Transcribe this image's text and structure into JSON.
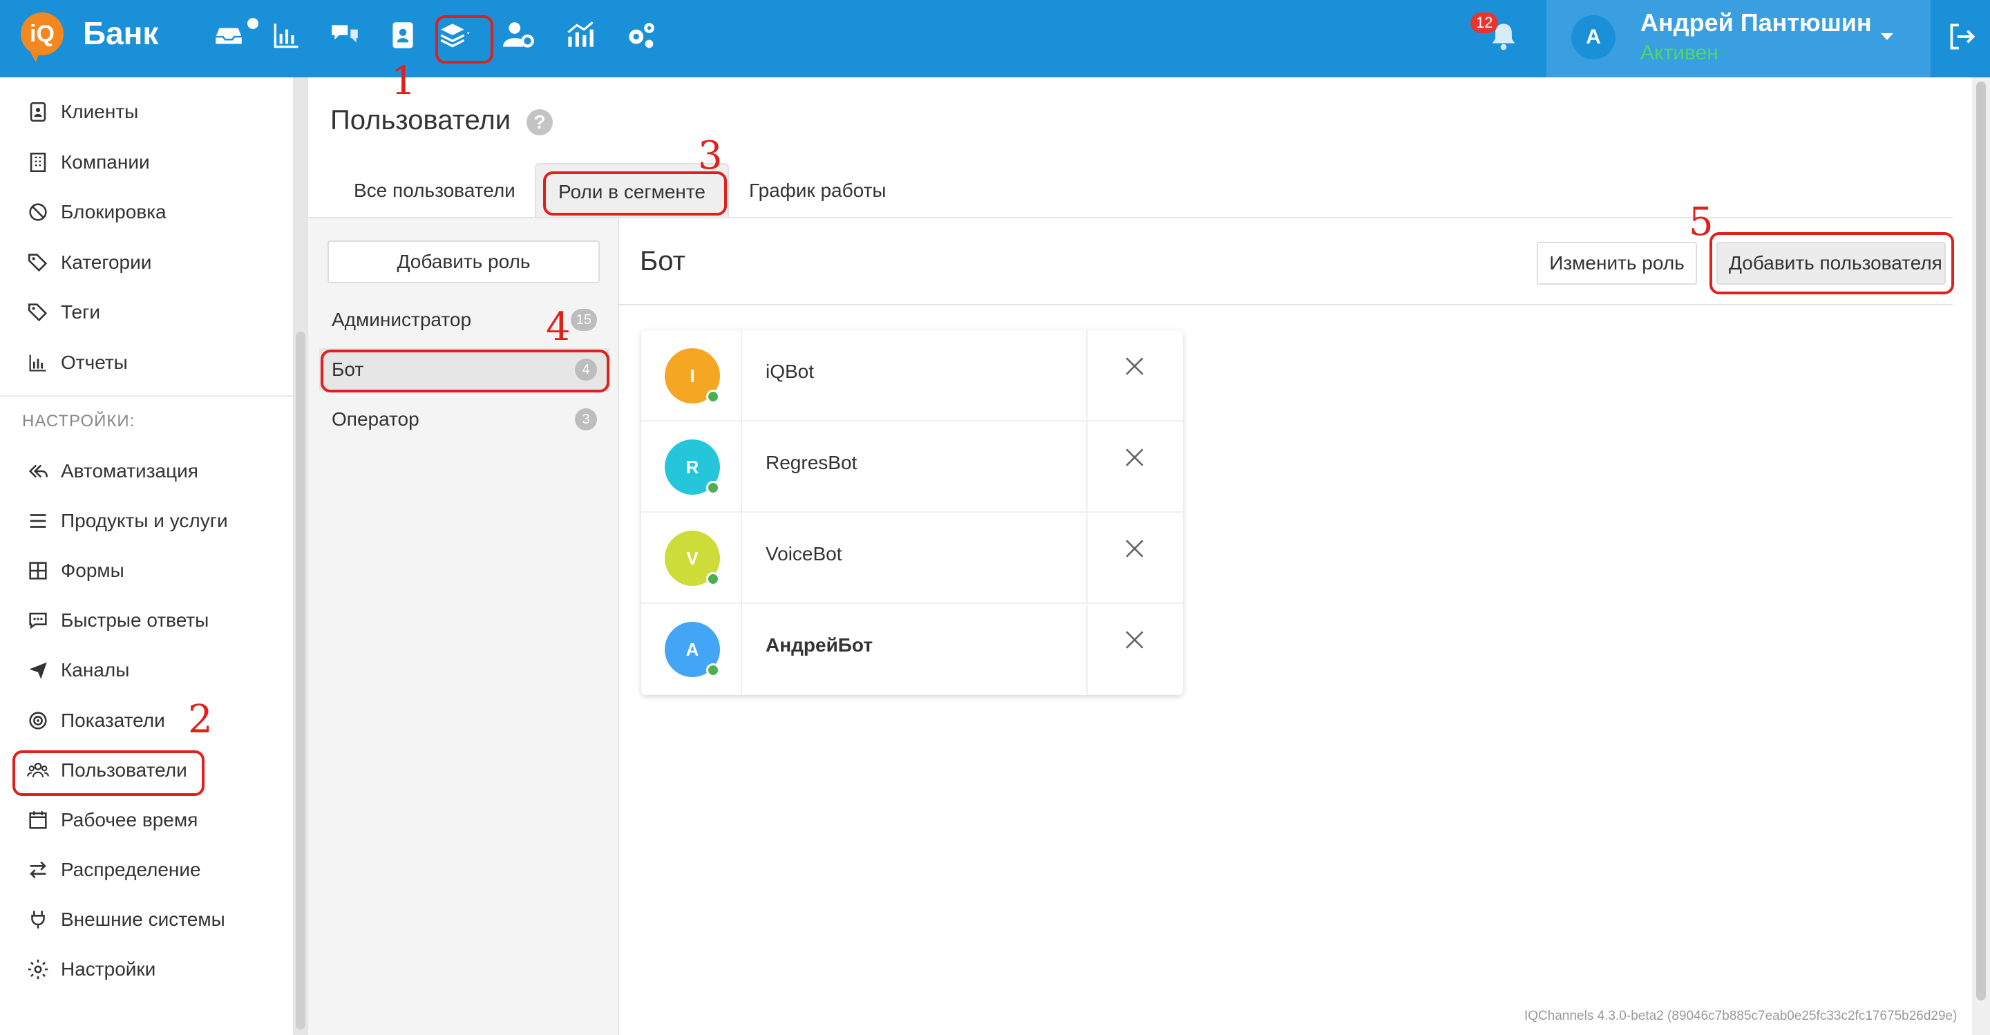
{
  "header": {
    "logo_text": "iQ",
    "brand": "Банк",
    "nav_icons": [
      "inbox-icon",
      "bar-chart-icon",
      "chat-icon",
      "contacts-icon",
      "layers-icon",
      "users-settings-icon",
      "analytics-icon",
      "settings-cogs-icon"
    ],
    "notifications_count": "12",
    "user": {
      "initial": "А",
      "name": "Андрей Пантюшин",
      "status": "Активен"
    }
  },
  "sidebar": {
    "items_top": [
      {
        "label": "Клиенты",
        "icon": "contact-card-icon"
      },
      {
        "label": "Компании",
        "icon": "building-icon"
      },
      {
        "label": "Блокировка",
        "icon": "block-icon"
      },
      {
        "label": "Категории",
        "icon": "tags-icon"
      },
      {
        "label": "Теги",
        "icon": "tag-icon"
      },
      {
        "label": "Отчеты",
        "icon": "bar-chart-icon"
      }
    ],
    "settings_header": "НАСТРОЙКИ:",
    "items_settings": [
      {
        "label": "Автоматизация",
        "icon": "reply-all-icon"
      },
      {
        "label": "Продукты и услуги",
        "icon": "list-icon"
      },
      {
        "label": "Формы",
        "icon": "grid-icon"
      },
      {
        "label": "Быстрые ответы",
        "icon": "chat-dots-icon"
      },
      {
        "label": "Каналы",
        "icon": "paper-plane-icon"
      },
      {
        "label": "Показатели",
        "icon": "target-icon"
      },
      {
        "label": "Пользователи",
        "icon": "users-icon"
      },
      {
        "label": "Рабочее время",
        "icon": "calendar-icon"
      },
      {
        "label": "Распределение",
        "icon": "exchange-icon"
      },
      {
        "label": "Внешние системы",
        "icon": "plug-icon"
      },
      {
        "label": "Настройки",
        "icon": "gear-icon"
      }
    ]
  },
  "page": {
    "title": "Пользователи",
    "help": "?",
    "tabs": [
      {
        "label": "Все пользователи",
        "active": false
      },
      {
        "label": "Роли в сегменте",
        "active": true
      },
      {
        "label": "График работы",
        "active": false
      }
    ]
  },
  "roles": {
    "add_label": "Добавить роль",
    "items": [
      {
        "label": "Администратор",
        "count": "15",
        "active": false
      },
      {
        "label": "Бот",
        "count": "4",
        "active": true
      },
      {
        "label": "Оператор",
        "count": "3",
        "active": false
      }
    ]
  },
  "detail": {
    "title": "Бот",
    "edit_label": "Изменить роль",
    "add_user_label": "Добавить пользователя",
    "members": [
      {
        "initial": "I",
        "name": "iQBot",
        "color": "#f5a623",
        "bold": false
      },
      {
        "initial": "R",
        "name": "RegresBot",
        "color": "#26c6da",
        "bold": false
      },
      {
        "initial": "V",
        "name": "VoiceBot",
        "color": "#cddc39",
        "bold": false
      },
      {
        "initial": "A",
        "name": "АндрейБот",
        "color": "#42a5f5",
        "bold": true
      }
    ]
  },
  "footer": {
    "version": "IQChannels 4.3.0-beta2 (89046c7b885c7eab0e25fc33c2fc17675b26d29e)"
  },
  "annotations": [
    "1",
    "2",
    "3",
    "4",
    "5"
  ],
  "colors": {
    "topbar": "#1a90d8",
    "accent_orange": "#f5871f",
    "annotation_red": "#e0201a",
    "status_green": "#4cd964"
  }
}
